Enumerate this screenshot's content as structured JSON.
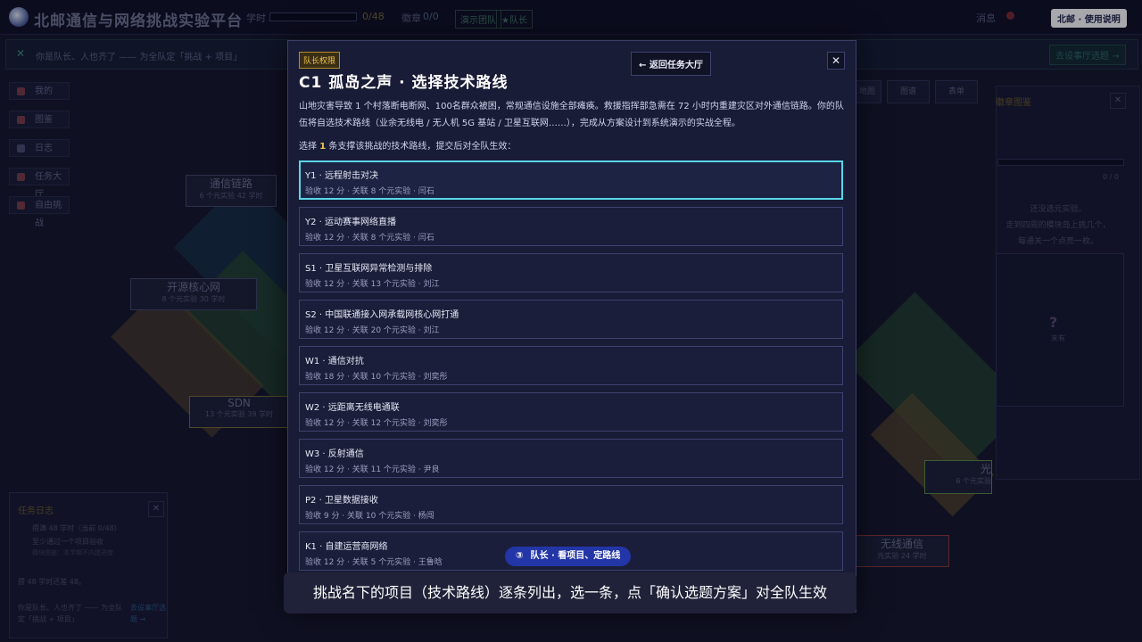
{
  "app": {
    "title": "北邮通信与网络挑战实验平台",
    "hours_label": "学时",
    "hours_value": "0/48",
    "honor_label": "徽章",
    "honor_value": "0/0",
    "team_badge": "演示团队",
    "role_badge": "★队长",
    "message_label": "消息",
    "help_button": "北邮 · 使用说明"
  },
  "banner": {
    "text": "你是队长、人也齐了 —— 为全队定「挑战 + 项目」",
    "button": "去设事厅选题 →"
  },
  "sidebar": {
    "items": [
      {
        "label": "我的"
      },
      {
        "label": "图鉴"
      },
      {
        "label": "日志"
      },
      {
        "label": "任务大厅"
      },
      {
        "label": "自由挑战"
      }
    ]
  },
  "map": {
    "zones": [
      {
        "name": "通信链路",
        "sub": "6 个元实验  42 学时"
      },
      {
        "name": "开源核心网",
        "sub": "8 个元实验  30 学时"
      },
      {
        "name": "SDN",
        "sub": "13 个元实验  39 学时"
      },
      {
        "name": "光",
        "sub": "6 个元实验"
      },
      {
        "name": "无线通信",
        "sub": "元实验  24 学时"
      }
    ],
    "view_tabs": [
      "地图",
      "图谱",
      "表单"
    ]
  },
  "right_panel": {
    "title": "徽章图鉴",
    "progress": "0 / 0",
    "hint1": "还没选元实验。",
    "hint2": "走到四周的模块岛上挑几个，",
    "hint3": "每通关一个点亮一枚。",
    "unknown": "未有"
  },
  "log_panel": {
    "title": "任务日志",
    "line1": "攒满 48 学时（当前 0/48）",
    "line2": "至少通过一个项目验收",
    "line3": "模块图鉴：本学期不内建进度",
    "line4": "攒 48 学时还差 48。",
    "footer": "你是队长、人也齐了 —— 为全队定「挑战 + 项目」",
    "footer_link": "去设事厅选题 →"
  },
  "modal": {
    "badge": "队长权限",
    "title": "C1  孤岛之声  ·  选择技术路线",
    "back_button": "← 返回任务大厅",
    "close": "✕",
    "description": "山地灾害导致 1 个村落断电断网、100名群众被困，常规通信设施全部瘫痪。救援指挥部急需在 72 小时内重建灾区对外通信链路。你的队伍将自选技术路线（业余无线电 / 无人机 5G 基站 / 卫星互联网……），完成从方案设计到系统演示的实战全程。",
    "prompt_before": "选择",
    "prompt_count": "1",
    "prompt_after": "条支撑该挑战的技术路线，提交后对全队生效：",
    "options": [
      {
        "title": "Y1 · 远程射击对决",
        "meta": "验收 12 分 · 关联 8 个元实验 · 闫石"
      },
      {
        "title": "Y2 · 运动赛事网络直播",
        "meta": "验收 12 分 · 关联 8 个元实验 · 闫石"
      },
      {
        "title": "S1 · 卫星互联网异常检测与排除",
        "meta": "验收 12 分 · 关联 13 个元实验 · 刘江"
      },
      {
        "title": "S2 · 中国联通接入网承载网核心网打通",
        "meta": "验收 12 分 · 关联 20 个元实验 · 刘江"
      },
      {
        "title": "W1 · 通信对抗",
        "meta": "验收 18 分 · 关联 10 个元实验 · 刘奕彤"
      },
      {
        "title": "W2 · 远距离无线电通联",
        "meta": "验收 12 分 · 关联 12 个元实验 · 刘奕彤"
      },
      {
        "title": "W3 · 反射通信",
        "meta": "验收 12 分 · 关联 11 个元实验 · 尹良"
      },
      {
        "title": "P2 · 卫星数据接收",
        "meta": "验收 9 分 · 关联 10 个元实验 · 杨闯"
      },
      {
        "title": "K1 · 自建运营商网络",
        "meta": "验收 12 分 · 关联 5 个元实验 · 王鲁晗"
      }
    ]
  },
  "tutorial": {
    "step_num": "③",
    "step_label": "队长 · 看项目、定路线",
    "caption": "挑战名下的项目（技术路线）逐条列出，选一条，点「确认选题方案」对全队生效"
  }
}
